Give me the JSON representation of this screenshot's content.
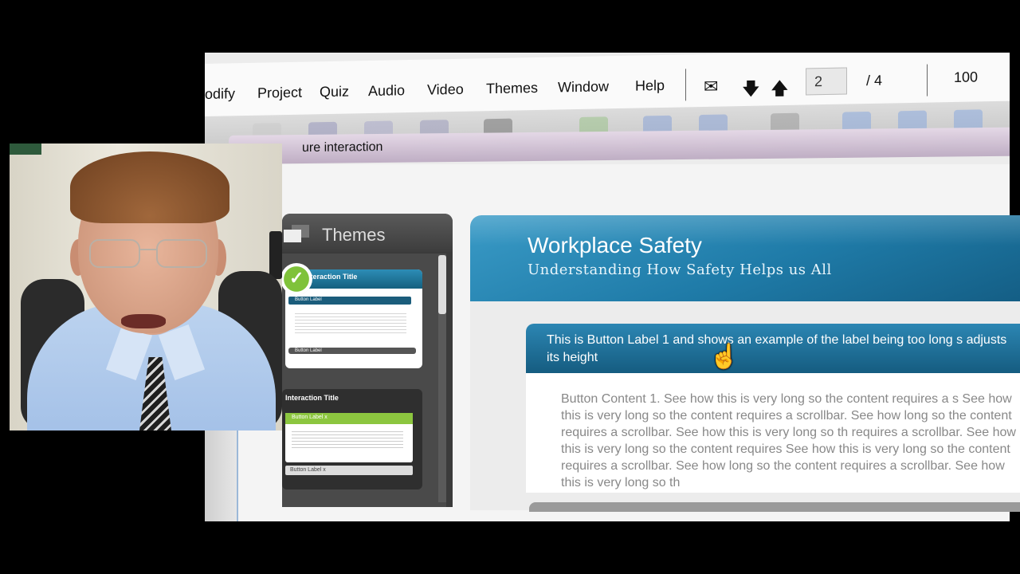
{
  "menu": {
    "items": [
      "odify",
      "Project",
      "Quiz",
      "Audio",
      "Video",
      "Themes",
      "Window",
      "Help"
    ]
  },
  "nav": {
    "mail_icon": "envelope-icon",
    "down_icon": "arrow-down-icon",
    "up_icon": "arrow-up-icon",
    "current_page": "2",
    "page_total": "/ 4",
    "zoom": "100"
  },
  "tab": {
    "title": "ure interaction"
  },
  "themes_panel": {
    "title": "Themes",
    "thumb1": {
      "title": "nteraction Title",
      "button1": "Button Label",
      "button2": "Button Label"
    },
    "thumb2": {
      "title": "Interaction Title",
      "button1": "Button Label x",
      "button2": "Button Label x"
    }
  },
  "slide": {
    "title": "Workplace Safety",
    "subtitle": "Understanding How Safety Helps us All",
    "button_label": "This is Button Label 1 and shows an example of the label being too long s adjusts its height",
    "content": "Button Content 1. See how this is very long so the content requires a s See how this is very long so the content requires a scrollbar. See how long so the content requires a scrollbar. See how this is very long so th requires a scrollbar. See how this is very long so the content requires See how this is very long so the content requires a scrollbar. See how long so the content requires a scrollbar. See how this is very long so th"
  },
  "colors": {
    "slide_header": "#1f7ba8",
    "accordion": "#155c80",
    "theme_green": "#8cc63f"
  }
}
